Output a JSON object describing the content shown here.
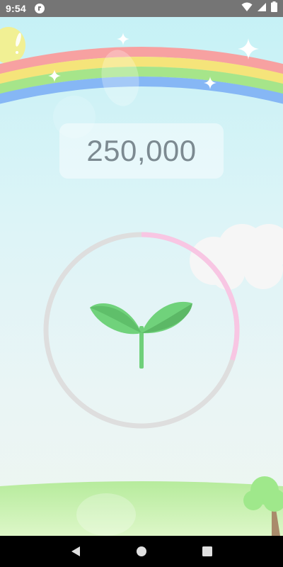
{
  "status_bar": {
    "time": "9:54",
    "notification_icon": "app-notification-icon",
    "icons": [
      "wifi-icon",
      "cellular-signal-icon",
      "battery-icon"
    ],
    "background": "#757575"
  },
  "scene": {
    "rainbow_colors": [
      "#f7a1a1",
      "#f5e47a",
      "#a6e58a",
      "#86b7f5"
    ],
    "sun_color": "#f5f08a"
  },
  "counter": {
    "value": "250,000",
    "text_color": "#7c8a91"
  },
  "progress": {
    "fraction": 0.3,
    "progress_color": "#f8c6e3",
    "track_color": "#dedede"
  },
  "plant": {
    "icon": "sprout-icon",
    "leaf_color": "#6fd07a"
  },
  "nav_bar": {
    "buttons": [
      "back-icon",
      "home-icon",
      "recents-icon"
    ]
  }
}
